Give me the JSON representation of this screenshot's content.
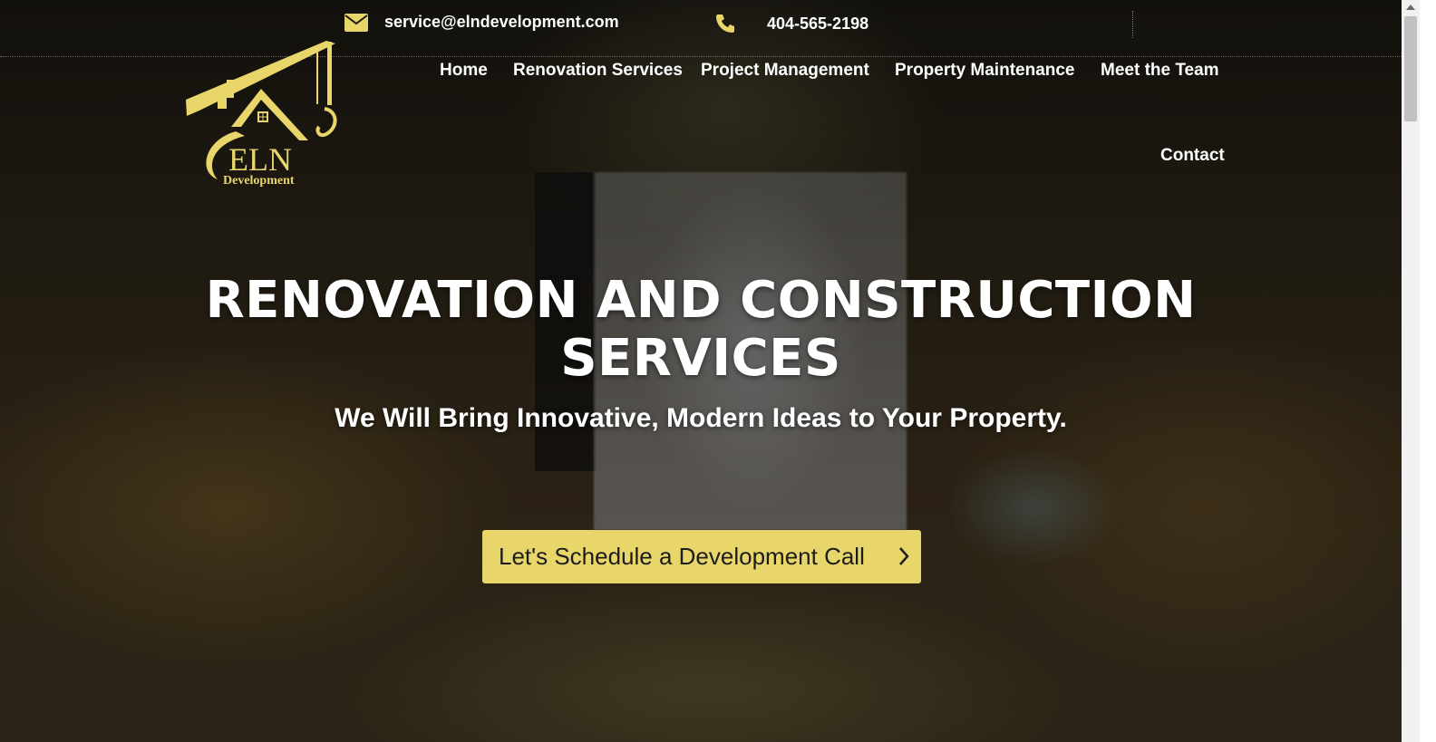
{
  "topbar": {
    "email": "service@elndevelopment.com",
    "email_icon": "envelope-icon",
    "phone": "404-565-2198",
    "phone_icon": "phone-icon"
  },
  "logo": {
    "text": "ELN",
    "subtext": "Development",
    "color": "#e8d66a"
  },
  "nav": {
    "items": [
      {
        "label": "Home"
      },
      {
        "label": "Renovation Services"
      },
      {
        "label": "Project Management"
      },
      {
        "label": "Property Maintenance"
      },
      {
        "label": "Meet the Team"
      },
      {
        "label": "Contact"
      }
    ]
  },
  "hero": {
    "title_line1": "RENOVATION AND CONSTRUCTION",
    "title_line2": "SERVICES",
    "subtitle": "We Will Bring Innovative, Modern Ideas to Your Property.",
    "cta_label": "Let's Schedule a Development Call",
    "cta_icon": "chevron-right-icon",
    "cta_color": "#e8d66a"
  },
  "colors": {
    "accent": "#e8d66a",
    "text": "#ffffff"
  }
}
